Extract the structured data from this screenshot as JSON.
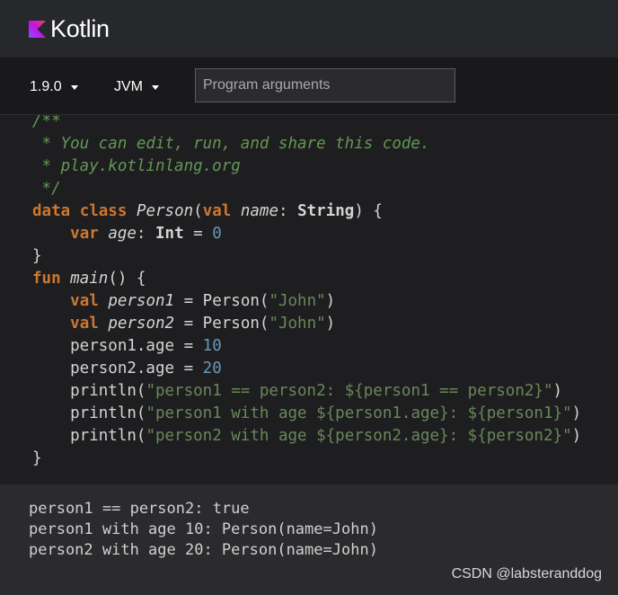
{
  "header": {
    "logo_text": "Kotlin",
    "logo_colors": [
      "#e44857",
      "#c711e1",
      "#7f52ff"
    ]
  },
  "toolbar": {
    "version": "1.9.0",
    "target": "JVM",
    "args_placeholder": "Program arguments"
  },
  "code": {
    "lines": [
      "/**",
      " * You can edit, run, and share this code.",
      " * play.kotlinlang.org",
      " */",
      "data class Person(val name: String) {",
      "    var age: Int = 0",
      "}",
      "fun main() {",
      "    val person1 = Person(\"John\")",
      "    val person2 = Person(\"John\")",
      "    person1.age = 10",
      "    person2.age = 20",
      "    println(\"person1 == person2: ${person1 == person2}\")",
      "    println(\"person1 with age ${person1.age}: ${person1}\")",
      "    println(\"person2 with age ${person2.age}: ${person2}\")",
      "}"
    ]
  },
  "output": {
    "lines": [
      "person1 == person2: true",
      "person1 with age 10: Person(name=John)",
      "person2 with age 20: Person(name=John)"
    ]
  },
  "watermark": "CSDN @labsteranddog"
}
